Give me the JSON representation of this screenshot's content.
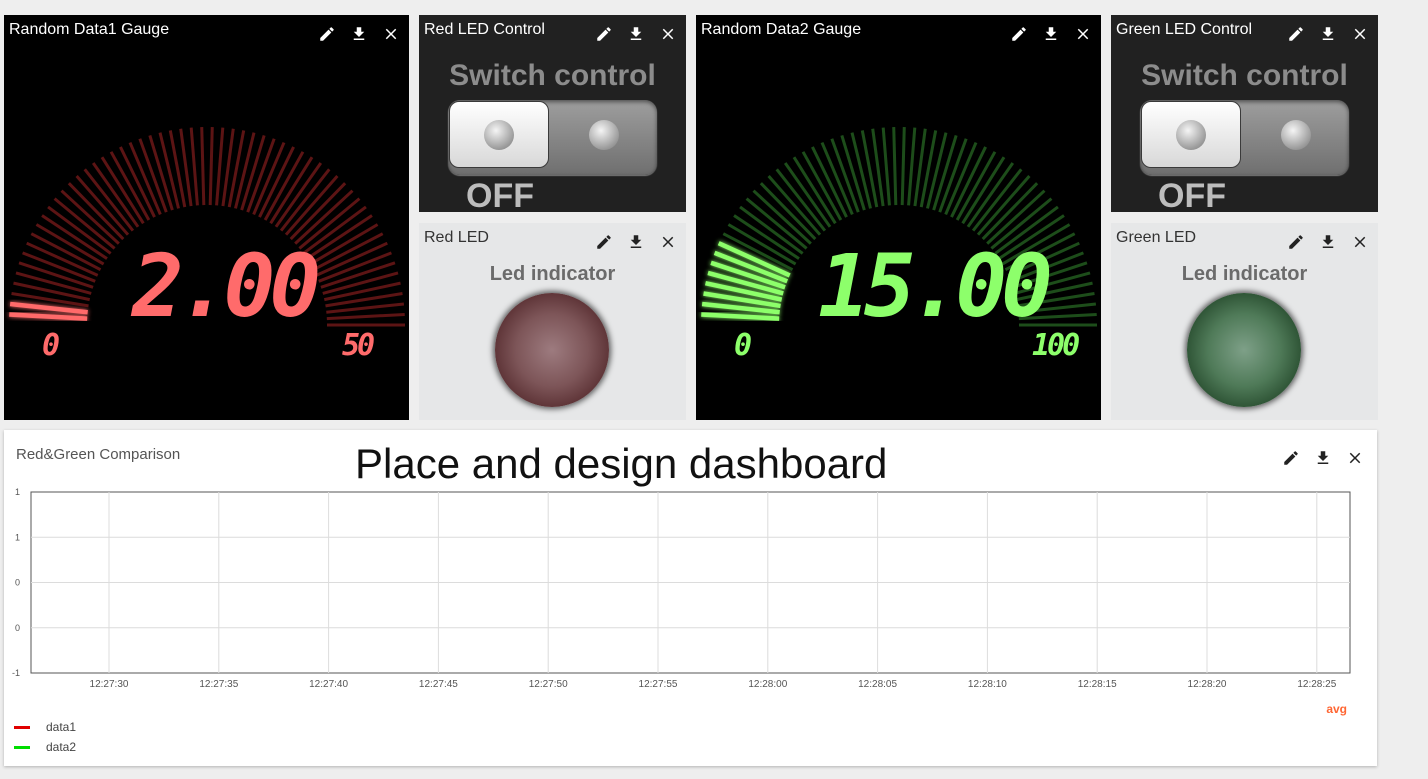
{
  "gauge1": {
    "title": "Random Data1 Gauge",
    "value": "2.00",
    "min": "0",
    "max": "50",
    "level": 0.04,
    "color": "#ff6b6b"
  },
  "red_switch": {
    "title": "Red LED Control",
    "label": "Switch control",
    "state": "OFF"
  },
  "red_led": {
    "title": "Red LED",
    "label": "Led indicator"
  },
  "gauge2": {
    "title": "Random Data2 Gauge",
    "value": "15.00",
    "min": "0",
    "max": "100",
    "level": 0.15,
    "color": "#8dff6b"
  },
  "green_switch": {
    "title": "Green LED Control",
    "label": "Switch control",
    "state": "OFF"
  },
  "green_led": {
    "title": "Green LED",
    "label": "Led indicator"
  },
  "overlay_text": "Place and design dashboard",
  "chart": {
    "title": "Red&Green Comparison",
    "avg_label": "avg",
    "avg_color": "#ff6633"
  },
  "icons": [
    "edit-icon",
    "download-icon",
    "close-icon"
  ],
  "chart_data": {
    "type": "line",
    "title": "Red&Green Comparison",
    "x": [
      "12:27:30",
      "12:27:35",
      "12:27:40",
      "12:27:45",
      "12:27:50",
      "12:27:55",
      "12:28:00",
      "12:28:05",
      "12:28:10",
      "12:28:15",
      "12:28:20",
      "12:28:25"
    ],
    "y_ticks": [
      "1",
      "1",
      "0",
      "0",
      "-1"
    ],
    "series": [
      {
        "name": "data1",
        "color": "#e00000",
        "values": []
      },
      {
        "name": "data2",
        "color": "#00dd00",
        "values": []
      }
    ],
    "grid": true,
    "legend": "bottom-left"
  }
}
